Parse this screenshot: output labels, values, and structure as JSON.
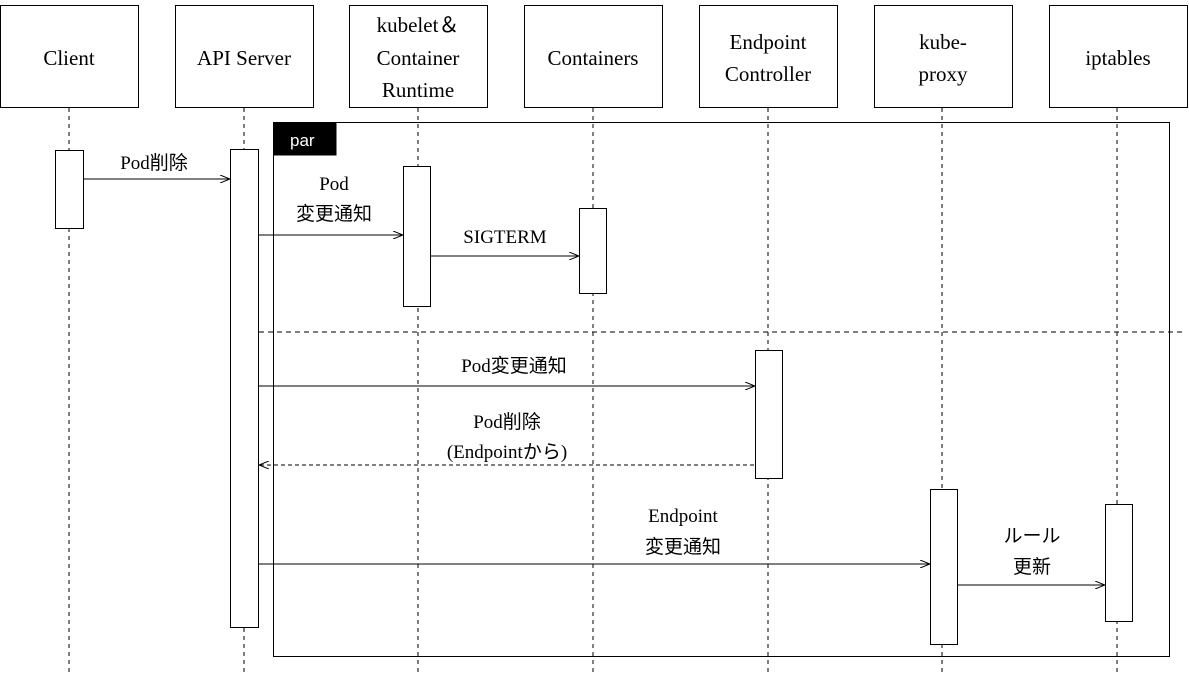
{
  "participants": [
    {
      "id": "client",
      "lines": [
        "Client"
      ]
    },
    {
      "id": "api-server",
      "lines": [
        "API Server"
      ]
    },
    {
      "id": "kubelet",
      "lines": [
        "kubelet＆",
        "Container",
        "Runtime"
      ]
    },
    {
      "id": "containers",
      "lines": [
        "Containers"
      ]
    },
    {
      "id": "endpoint-controller",
      "lines": [
        "Endpoint",
        "Controller"
      ]
    },
    {
      "id": "kube-proxy",
      "lines": [
        "kube-",
        "proxy"
      ]
    },
    {
      "id": "iptables",
      "lines": [
        "iptables"
      ]
    }
  ],
  "fragment": {
    "operator": "par"
  },
  "messages": [
    {
      "id": "client-delete-pod",
      "from": "client",
      "to": "api-server",
      "style": "solid",
      "label": [
        "Pod削除"
      ]
    },
    {
      "id": "pod-change-to-kubelet",
      "from": "api-server",
      "to": "kubelet",
      "style": "solid",
      "label": [
        "Pod",
        "変更通知"
      ]
    },
    {
      "id": "sigterm",
      "from": "kubelet",
      "to": "containers",
      "style": "solid",
      "label": [
        "SIGTERM"
      ]
    },
    {
      "id": "pod-change-to-endpoint",
      "from": "api-server",
      "to": "endpoint-controller",
      "style": "solid",
      "label": [
        "Pod変更通知"
      ]
    },
    {
      "id": "remove-from-endpoint",
      "from": "endpoint-controller",
      "to": "api-server",
      "style": "dashed",
      "label": [
        "Pod削除",
        "(Endpointから)"
      ]
    },
    {
      "id": "endpoint-change-to-proxy",
      "from": "api-server",
      "to": "kube-proxy",
      "style": "solid",
      "label": [
        "Endpoint",
        "変更通知"
      ]
    },
    {
      "id": "rule-update",
      "from": "kube-proxy",
      "to": "iptables",
      "style": "solid",
      "label": [
        "ルール",
        "更新"
      ]
    }
  ]
}
